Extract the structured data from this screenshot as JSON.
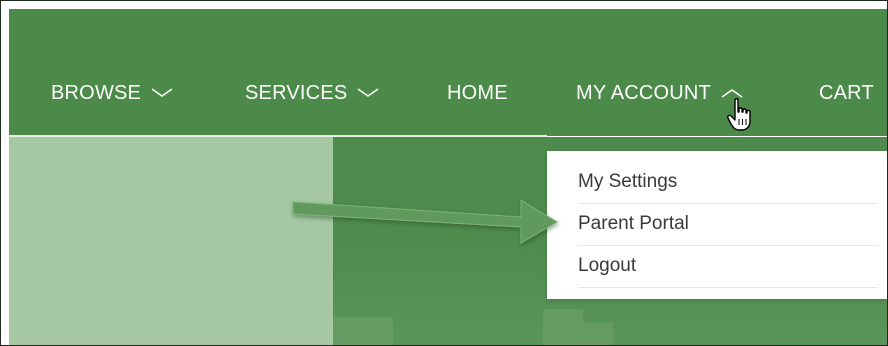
{
  "nav": {
    "items": [
      {
        "label": "BROWSE",
        "has_chevron": true,
        "expanded": false
      },
      {
        "label": "SERVICES",
        "has_chevron": true,
        "expanded": false
      },
      {
        "label": "HOME",
        "has_chevron": false
      },
      {
        "label": "MY ACCOUNT",
        "has_chevron": true,
        "expanded": true
      },
      {
        "label": "CART",
        "has_chevron": false
      }
    ]
  },
  "dropdown": {
    "items": [
      {
        "label": "My Settings"
      },
      {
        "label": "Parent Portal"
      },
      {
        "label": "Logout"
      }
    ]
  },
  "annotation": {
    "type": "arrow",
    "points_to": "Parent Portal",
    "color": "#5e9a5c"
  },
  "colors": {
    "nav_background": "#4b8a49",
    "hero_left": "#a5c8a3",
    "dropdown_background": "#ffffff"
  },
  "icons": [
    "chevron-down-icon",
    "chevron-up-icon",
    "hand-cursor-icon",
    "annotation-arrow-icon"
  ]
}
